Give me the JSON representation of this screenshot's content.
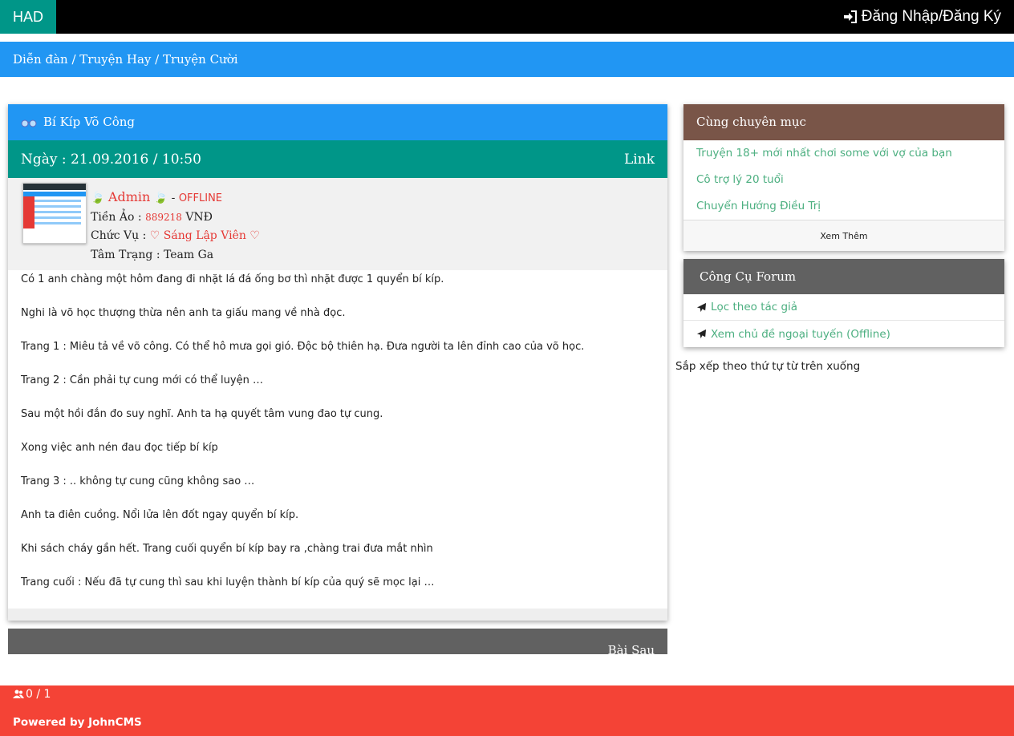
{
  "header": {
    "brand": "HAD",
    "login_label": "Đăng Nhập/Đăng Ký"
  },
  "breadcrumb": "Diễn đàn / Truyện Hay / Truyện Cười",
  "topic": {
    "title": "Bí Kíp Võ Công",
    "date": "Ngày : 21.09.2016 / 10:50",
    "link_label": "Link"
  },
  "author": {
    "name": "Admin",
    "status": "OFFLINE",
    "money_label": "Tiền Ảo : ",
    "money_value": "889218",
    "money_unit": " VNĐ",
    "role_label": "Chức Vụ : ",
    "role_value": "Sáng Lập Viên",
    "mood_label": "Tâm Trạng : ",
    "mood_value": "Team Ga"
  },
  "post": {
    "paragraphs": [
      "Có 1 anh chàng một hôm đang đi nhặt lá đá ống bơ thì nhặt được 1 quyển bí kíp.",
      "Nghi là võ học thượng thừa nên anh ta giấu mang về nhà đọc.",
      "Trang 1 : Miêu tả về võ công. Có thể hô mưa gọi gió. Độc bộ thiên hạ. Đưa người ta lên đỉnh cao của võ học.",
      "Trang 2 : Cần phải tự cung mới có thể luyện …",
      "Sau một hồi đắn đo suy nghĩ. Anh ta hạ quyết tâm vung đao tự cung.",
      "Xong việc anh nén đau đọc tiếp bí kíp",
      "Trang 3 : .. không tự cung cũng không sao …",
      "Anh ta điên cuồng. Nổi lửa lên đốt ngay quyển bí kíp.",
      "Khi sách cháy gần hết. Trang cuối quyển bí kíp bay ra ,chàng trai đưa mắt nhìn",
      "Trang cuối : Nếu đã tự cung thì sau khi luyện thành bí kíp của quý sẽ mọc lại …"
    ]
  },
  "nav": {
    "next_label": "Bài Sau"
  },
  "sidebar": {
    "same_category": {
      "title": "Cùng chuyên mục",
      "items": [
        "Truyện 18+ mới nhất chơi some với vợ của bạn",
        "Cô trợ lý 20 tuổi",
        "Chuyển Hướng Điều Trị"
      ],
      "more_label": "Xem Thêm"
    },
    "tools": {
      "title": "Công Cụ Forum",
      "items": [
        "Lọc theo tác giả",
        "Xem chủ đề ngoại tuyến (Offline)"
      ]
    },
    "sort_note": "Sắp xếp theo thứ tự từ trên xuống"
  },
  "footer": {
    "online": "0 / 1",
    "powered": "Powered by JohnCMS"
  },
  "colors": {
    "teal": "#009688",
    "blue": "#2196f3",
    "brown": "#795548",
    "gray": "#616161",
    "red": "#f44336",
    "link_green": "#4caf80"
  }
}
